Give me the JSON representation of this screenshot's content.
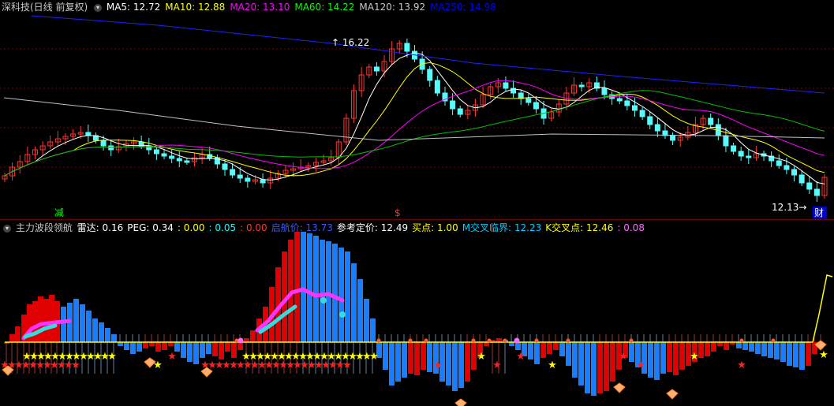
{
  "title": "深科技(日线 前复权)",
  "ma": [
    {
      "label": "MA5:",
      "value": "12.72",
      "color": "#ffffff"
    },
    {
      "label": "MA10:",
      "value": "12.88",
      "color": "#ffff00"
    },
    {
      "label": "MA20:",
      "value": "13.10",
      "color": "#ff00ff"
    },
    {
      "label": "MA60:",
      "value": "14.22",
      "color": "#00ff00"
    },
    {
      "label": "MA120:",
      "value": "13.92",
      "color": "#c8c8c8"
    },
    {
      "label": "MA250:",
      "value": "14.98",
      "color": "#0000ff"
    }
  ],
  "high_label": "16.22",
  "low_label": "12.13",
  "markers": {
    "reduce": "减",
    "dollar": "$",
    "finance": "财"
  },
  "indicator": {
    "name": "主力波段领航",
    "items": [
      {
        "label": "雷达:",
        "value": "0.16",
        "color": "#ffffff"
      },
      {
        "label": "PEG:",
        "value": "0.34",
        "color": "#ffffff"
      },
      {
        "label": ":",
        "value": "0.00",
        "color": "#ffff00"
      },
      {
        "label": ":",
        "value": "0.05",
        "color": "#00ffff"
      },
      {
        "label": ":",
        "value": "0.00",
        "color": "#ff3333"
      },
      {
        "label": "启航价:",
        "value": "13.73",
        "color": "#3355ff"
      },
      {
        "label": "参考定价:",
        "value": "12.49",
        "color": "#ffffff"
      },
      {
        "label": "买点:",
        "value": "1.00",
        "color": "#ffff00"
      },
      {
        "label": "M交叉临界:",
        "value": "12.23",
        "color": "#00ccff"
      },
      {
        "label": "K交叉点:",
        "value": "12.46",
        "color": "#ffff00"
      },
      {
        "label": ":",
        "value": "0.08",
        "color": "#ff66ff"
      }
    ]
  },
  "colors": {
    "up": "#ff3232",
    "down": "#54fcfc",
    "background": "#000000"
  }
}
